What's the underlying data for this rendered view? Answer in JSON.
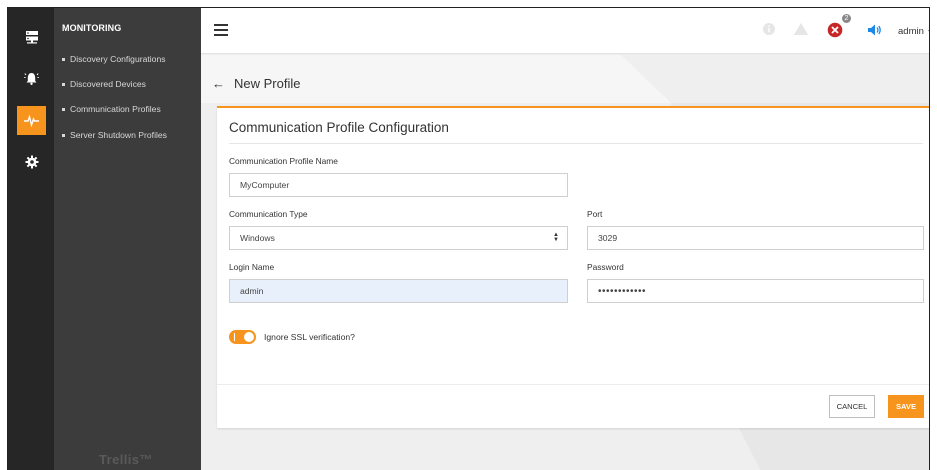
{
  "sidebar": {
    "section_title": "MONITORING",
    "items": [
      {
        "label": "Discovery Configurations"
      },
      {
        "label": "Discovered Devices"
      },
      {
        "label": "Communication Profiles"
      },
      {
        "label": "Server Shutdown Profiles"
      }
    ],
    "brand": "Trellis™",
    "rail_icons": [
      "server-icon",
      "alarm-bell-icon",
      "pulse-icon",
      "gear-icon"
    ],
    "active_rail": "pulse-icon"
  },
  "header": {
    "notifications": {
      "info_icon": "info-icon",
      "warning_icon": "warning-icon",
      "error_icon": "error-icon",
      "error_count": "2",
      "sound_icon": "speaker-icon"
    },
    "user": "admin",
    "user_caret": "▼"
  },
  "page": {
    "back": "←",
    "title": "New Profile"
  },
  "form": {
    "title": "Communication Profile Configuration",
    "profile_name_label": "Communication Profile Name",
    "profile_name_value": "MyComputer",
    "comm_type_label": "Communication Type",
    "comm_type_value": "Windows",
    "port_label": "Port",
    "port_value": "3029",
    "login_label": "Login Name",
    "login_value": "admin",
    "password_label": "Password",
    "password_value": "••••••••••••",
    "ssl_label": "Ignore SSL verification?",
    "ssl_enabled": true,
    "cancel_label": "CANCEL",
    "save_label": "SAVE"
  },
  "colors": {
    "accent": "#f7941d",
    "rail_bg": "#262626",
    "nav_bg": "#3c3c3c",
    "error": "#c62828",
    "sound": "#1e88e5"
  }
}
